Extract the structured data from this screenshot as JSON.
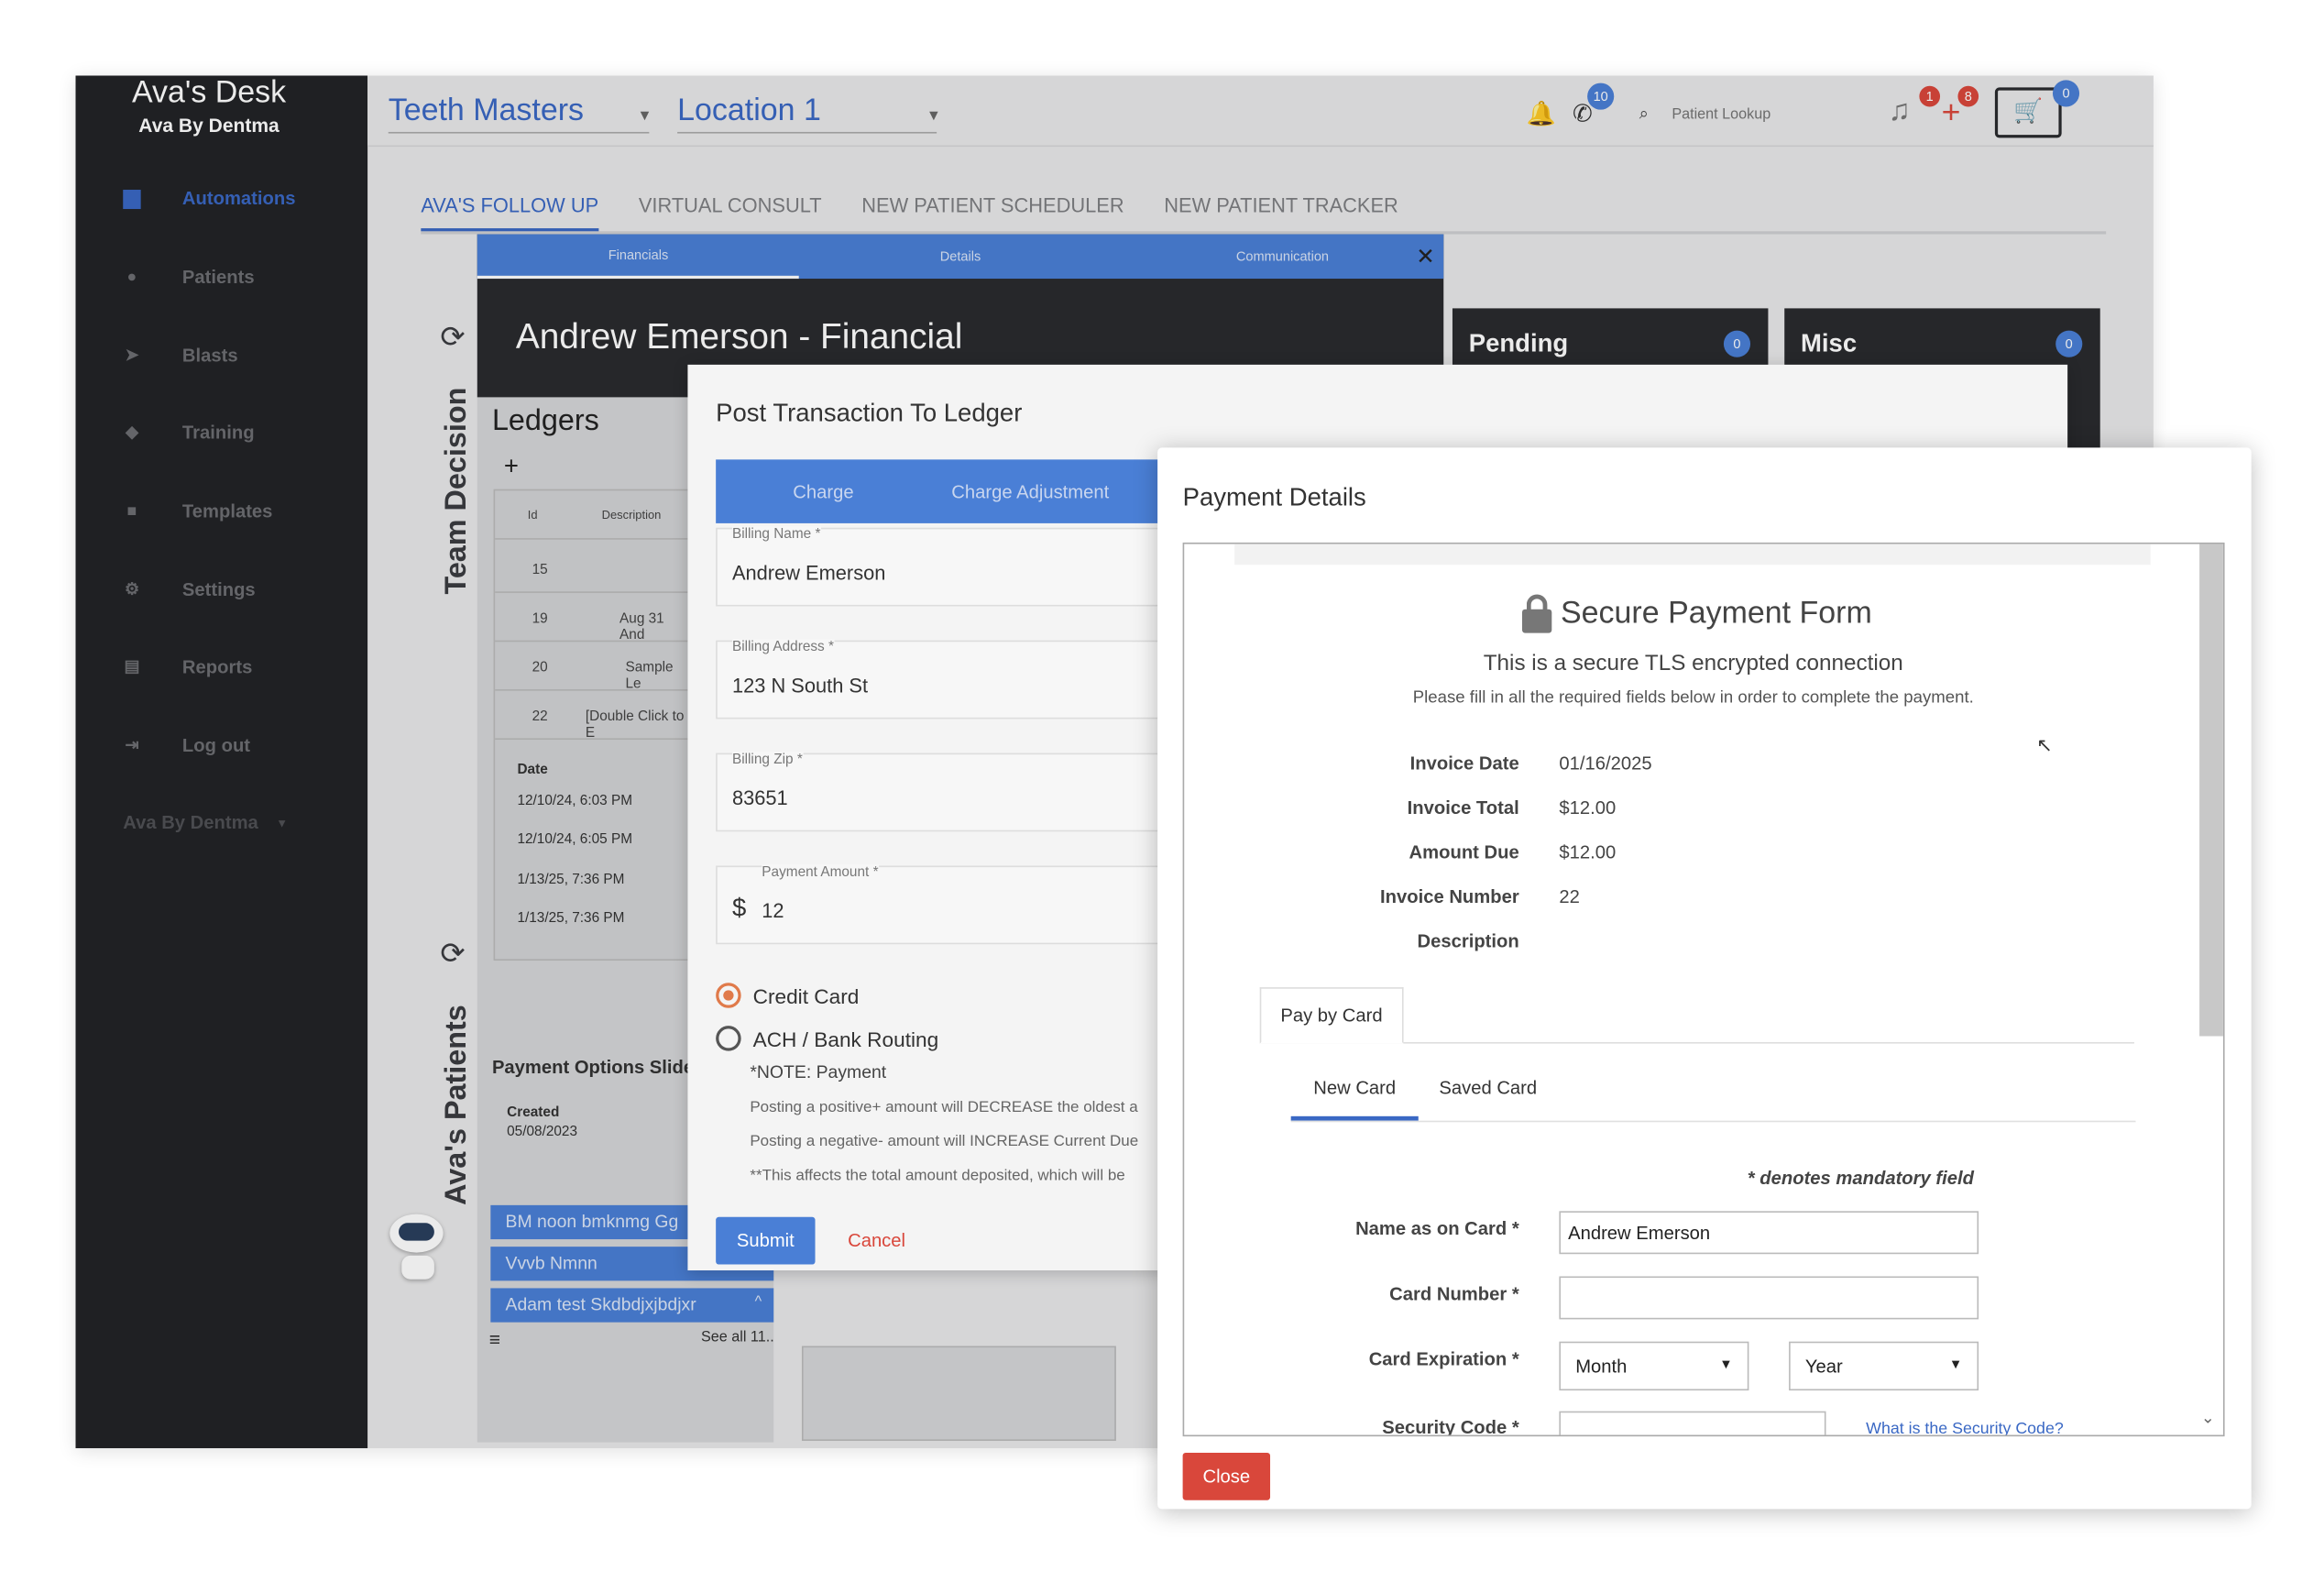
{
  "sidebar": {
    "title": "Ava's Desk",
    "subtitle": "Ava By Dentma",
    "items": [
      {
        "label": "Automations",
        "icon": "robot-icon"
      },
      {
        "label": "Patients",
        "icon": "users-icon"
      },
      {
        "label": "Blasts",
        "icon": "send-icon"
      },
      {
        "label": "Training",
        "icon": "graduation-icon"
      },
      {
        "label": "Templates",
        "icon": "copy-icon"
      },
      {
        "label": "Settings",
        "icon": "gear-icon"
      },
      {
        "label": "Reports",
        "icon": "file-icon"
      },
      {
        "label": "Log out",
        "icon": "logout-icon"
      }
    ],
    "footer": "Ava By Dentma"
  },
  "topbar": {
    "practice": "Teeth Masters",
    "location": "Location 1",
    "phone_badge": "10",
    "search_placeholder": "Patient Lookup",
    "bell_badge": "1",
    "plus_badge": "8",
    "cart_badge": "0"
  },
  "tabs": [
    "AVA'S FOLLOW UP",
    "VIRTUAL CONSULT",
    "NEW PATIENT SCHEDULER",
    "NEW PATIENT TRACKER"
  ],
  "financial": {
    "tabs": [
      "Financials",
      "Details",
      "Communication"
    ],
    "title": "Andrew Emerson - Financial",
    "ledgers_title": "Ledgers",
    "add": "+",
    "ledger_header": {
      "id": "Id",
      "description": "Description"
    },
    "ledger_rows": [
      {
        "id": "15",
        "description": ""
      },
      {
        "id": "19",
        "description": "Aug 31 And"
      },
      {
        "id": "20",
        "description": "Sample Le"
      },
      {
        "id": "22",
        "description": "[Double Click to E"
      }
    ],
    "date_header": "Date",
    "dates": [
      "12/10/24, 6:03 PM",
      "12/10/24, 6:05 PM",
      "1/13/25, 7:36 PM",
      "1/13/25, 7:36 PM"
    ]
  },
  "board": {
    "team_decision": "Team Decision",
    "avas_patients": "Ava's Patients",
    "pending": {
      "label": "Pending",
      "count": "0"
    },
    "misc": {
      "label": "Misc",
      "count": "0"
    },
    "slider_title": "Payment Options Slider",
    "created_label": "Created",
    "created_date": "05/08/2023",
    "chips": [
      "BM noon bmknmg Gg",
      "Vvvb Nmnn",
      "Adam test Skdbdjxjbdjxr"
    ],
    "see_all": "See all 11..",
    "menu_icon": "≡"
  },
  "post": {
    "title": "Post Transaction To Ledger",
    "tabs": [
      "Charge",
      "Charge Adjustment"
    ],
    "fields": [
      {
        "label": "Billing Name *",
        "value": "Andrew Emerson"
      },
      {
        "label": "Billing Address *",
        "value": "123 N South St"
      },
      {
        "label": "Billing Zip *",
        "value": "83651"
      }
    ],
    "amount_label": "Payment Amount *",
    "amount_currency": "$",
    "amount_value": "12",
    "methods": [
      "Credit Card",
      "ACH / Bank Routing"
    ],
    "note_title": "*NOTE: Payment",
    "notes": [
      "Posting a positive+ amount will DECREASE the oldest a",
      "Posting a negative- amount will INCREASE Current Due",
      "**This affects the total amount deposited, which will be"
    ],
    "submit": "Submit",
    "cancel": "Cancel"
  },
  "payment": {
    "title": "Payment Details",
    "form_title": "Secure Payment Form",
    "subtitle": "This is a secure TLS encrypted connection",
    "instructions": "Please fill in all the required fields below in order to complete the payment.",
    "invoice": [
      {
        "label": "Invoice Date",
        "value": "01/16/2025"
      },
      {
        "label": "Invoice Total",
        "value": "$12.00"
      },
      {
        "label": "Amount Due",
        "value": "$12.00"
      },
      {
        "label": "Invoice Number",
        "value": "22"
      },
      {
        "label": "Description",
        "value": ""
      }
    ],
    "pay_by_card": "Pay by Card",
    "new_card": "New Card",
    "saved_card": "Saved Card",
    "mandatory_note": "* denotes mandatory field",
    "name_label": "Name as on Card *",
    "name_value": "Andrew Emerson",
    "card_number_label": "Card Number *",
    "expiration_label": "Card Expiration *",
    "month": "Month",
    "year": "Year",
    "security_label": "Security Code *",
    "security_help": "What is the Security Code?",
    "close": "Close"
  },
  "colors": {
    "accent": "#4a7fd6",
    "sidebar": "#222326",
    "close": "#d9473b"
  }
}
